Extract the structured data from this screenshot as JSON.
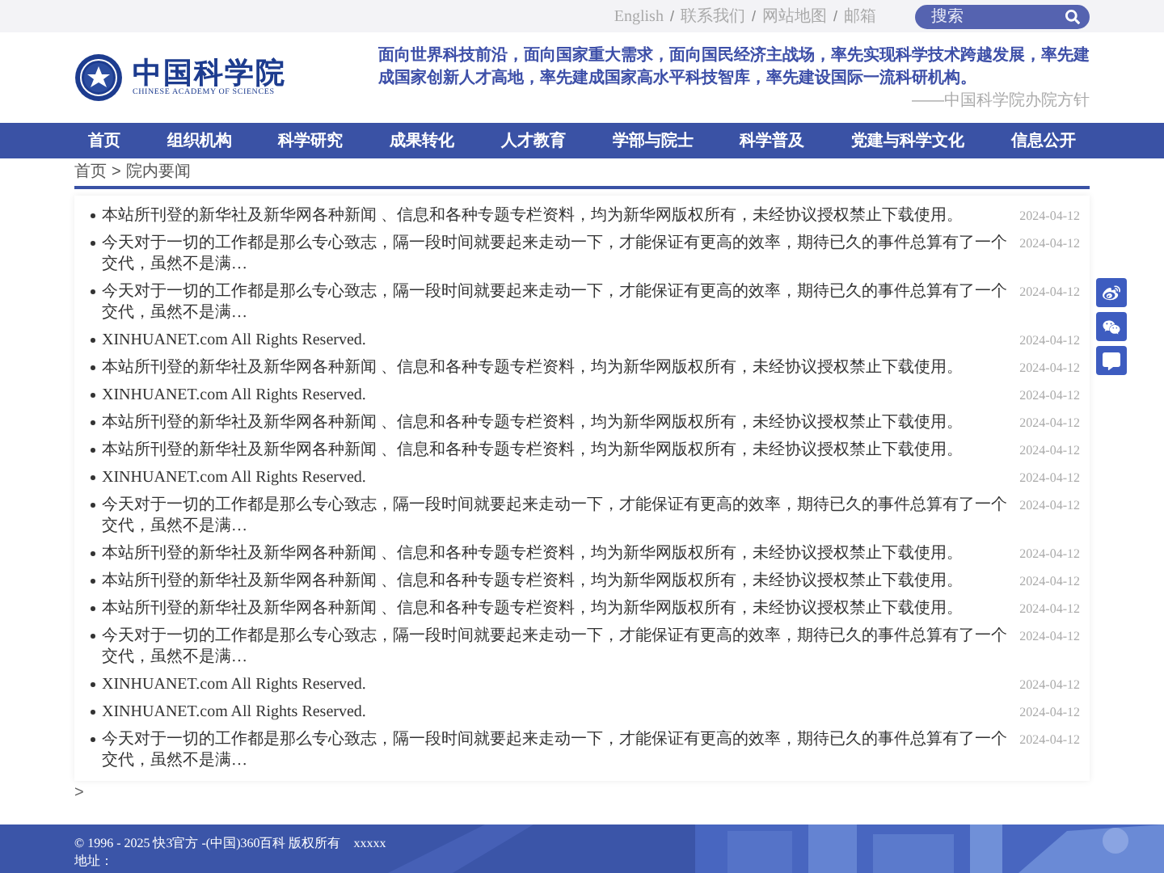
{
  "top_bar": {
    "links": [
      "English",
      "联系我们",
      "网站地图",
      "邮箱"
    ],
    "separator": "/",
    "search": {
      "placeholder": "搜索"
    }
  },
  "header": {
    "logo": {
      "name": "中国科学院",
      "subtitle": "CHINESE ACADEMY OF SCIENCES"
    },
    "slogan": "面向世界科技前沿，面向国家重大需求，面向国民经济主战场，率先实现科学技术跨越发展，率先建成国家创新人才高地，率先建成国家高水平科技智库，率先建设国际一流科研机构。",
    "slogan_source": "——中国科学院办院方针"
  },
  "nav": [
    "首页",
    "组织机构",
    "科学研究",
    "成果转化",
    "人才教育",
    "学部与院士",
    "科学普及",
    "党建与科学文化",
    "信息公开"
  ],
  "breadcrumb": {
    "home": "首页",
    "separator": ">",
    "current": "院内要闻"
  },
  "news": [
    {
      "title": "本站所刊登的新华社及新华网各种新闻 、信息和各种专题专栏资料，均为新华网版权所有，未经协议授权禁止下载使用。",
      "date": "2024-04-12"
    },
    {
      "title": "今天对于一切的工作都是那么专心致志，隔一段时间就要起来走动一下，才能保证有更高的效率，期待已久的事件总算有了一个交代，虽然不是满…",
      "date": "2024-04-12"
    },
    {
      "title": "今天对于一切的工作都是那么专心致志，隔一段时间就要起来走动一下，才能保证有更高的效率，期待已久的事件总算有了一个交代，虽然不是满…",
      "date": "2024-04-12"
    },
    {
      "title": "XINHUANET.com All Rights Reserved.",
      "date": "2024-04-12"
    },
    {
      "title": "本站所刊登的新华社及新华网各种新闻 、信息和各种专题专栏资料，均为新华网版权所有，未经协议授权禁止下载使用。",
      "date": "2024-04-12"
    },
    {
      "title": "XINHUANET.com All Rights Reserved.",
      "date": "2024-04-12"
    },
    {
      "title": "本站所刊登的新华社及新华网各种新闻 、信息和各种专题专栏资料，均为新华网版权所有，未经协议授权禁止下载使用。",
      "date": "2024-04-12"
    },
    {
      "title": "本站所刊登的新华社及新华网各种新闻 、信息和各种专题专栏资料，均为新华网版权所有，未经协议授权禁止下载使用。",
      "date": "2024-04-12"
    },
    {
      "title": "XINHUANET.com All Rights Reserved.",
      "date": "2024-04-12"
    },
    {
      "title": "今天对于一切的工作都是那么专心致志，隔一段时间就要起来走动一下，才能保证有更高的效率，期待已久的事件总算有了一个交代，虽然不是满…",
      "date": "2024-04-12"
    },
    {
      "title": "本站所刊登的新华社及新华网各种新闻 、信息和各种专题专栏资料，均为新华网版权所有，未经协议授权禁止下载使用。",
      "date": "2024-04-12"
    },
    {
      "title": "本站所刊登的新华社及新华网各种新闻 、信息和各种专题专栏资料，均为新华网版权所有，未经协议授权禁止下载使用。",
      "date": "2024-04-12"
    },
    {
      "title": "本站所刊登的新华社及新华网各种新闻 、信息和各种专题专栏资料，均为新华网版权所有，未经协议授权禁止下载使用。",
      "date": "2024-04-12"
    },
    {
      "title": "今天对于一切的工作都是那么专心致志，隔一段时间就要起来走动一下，才能保证有更高的效率，期待已久的事件总算有了一个交代，虽然不是满…",
      "date": "2024-04-12"
    },
    {
      "title": "XINHUANET.com All Rights Reserved.",
      "date": "2024-04-12"
    },
    {
      "title": "XINHUANET.com All Rights Reserved.",
      "date": "2024-04-12"
    },
    {
      "title": "今天对于一切的工作都是那么专心致志，隔一段时间就要起来走动一下，才能保证有更高的效率，期待已久的事件总算有了一个交代，虽然不是满…",
      "date": "2024-04-12"
    }
  ],
  "pager": ">",
  "footer": {
    "copyright": "© 1996 - 2025 快3官方 -(中国)360百科 版权所有",
    "extra": "xxxxx",
    "address": "地址："
  }
}
